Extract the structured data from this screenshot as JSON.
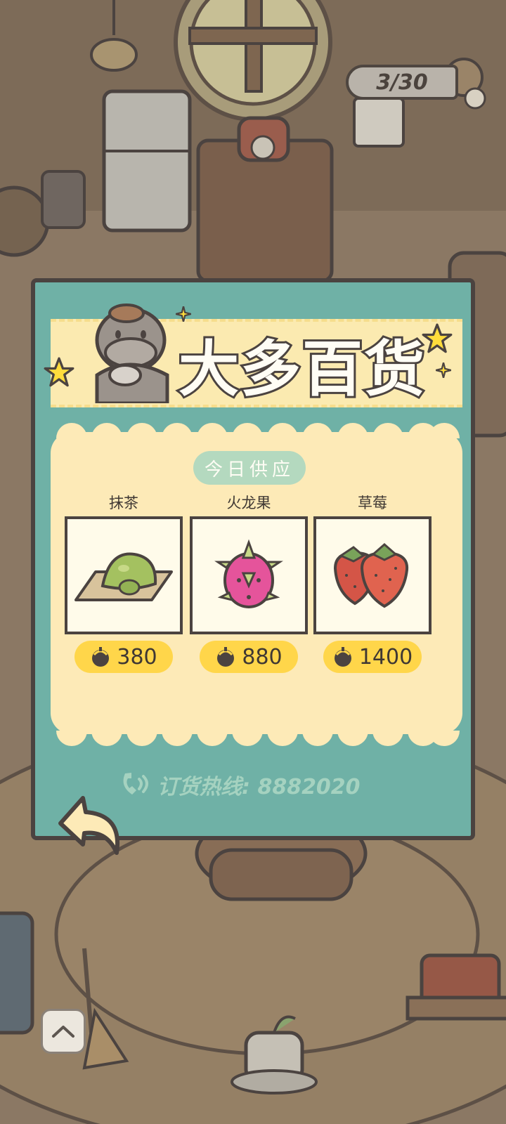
{
  "room": {
    "counter_text": "3/30",
    "plus_icon": "plus-icon"
  },
  "shop": {
    "title": "大多百货",
    "supply_label": "今日供应",
    "items": [
      {
        "name": "抹茶",
        "price": "380",
        "icon": "matcha-icon"
      },
      {
        "name": "火龙果",
        "price": "880",
        "icon": "dragon-fruit-icon"
      },
      {
        "name": "草莓",
        "price": "1400",
        "icon": "strawberry-icon"
      }
    ],
    "hotline": "订货热线: 8882020",
    "currency_icon": "acorn-icon",
    "back_icon": "back-arrow-icon",
    "up_icon": "chevron-up-icon"
  },
  "colors": {
    "panel": "#6fb1a6",
    "panel_border": "#4b4340",
    "content_bg": "#fdeab7",
    "price_bg": "#ffd64a",
    "supply_tag": "#b4d9bf"
  }
}
